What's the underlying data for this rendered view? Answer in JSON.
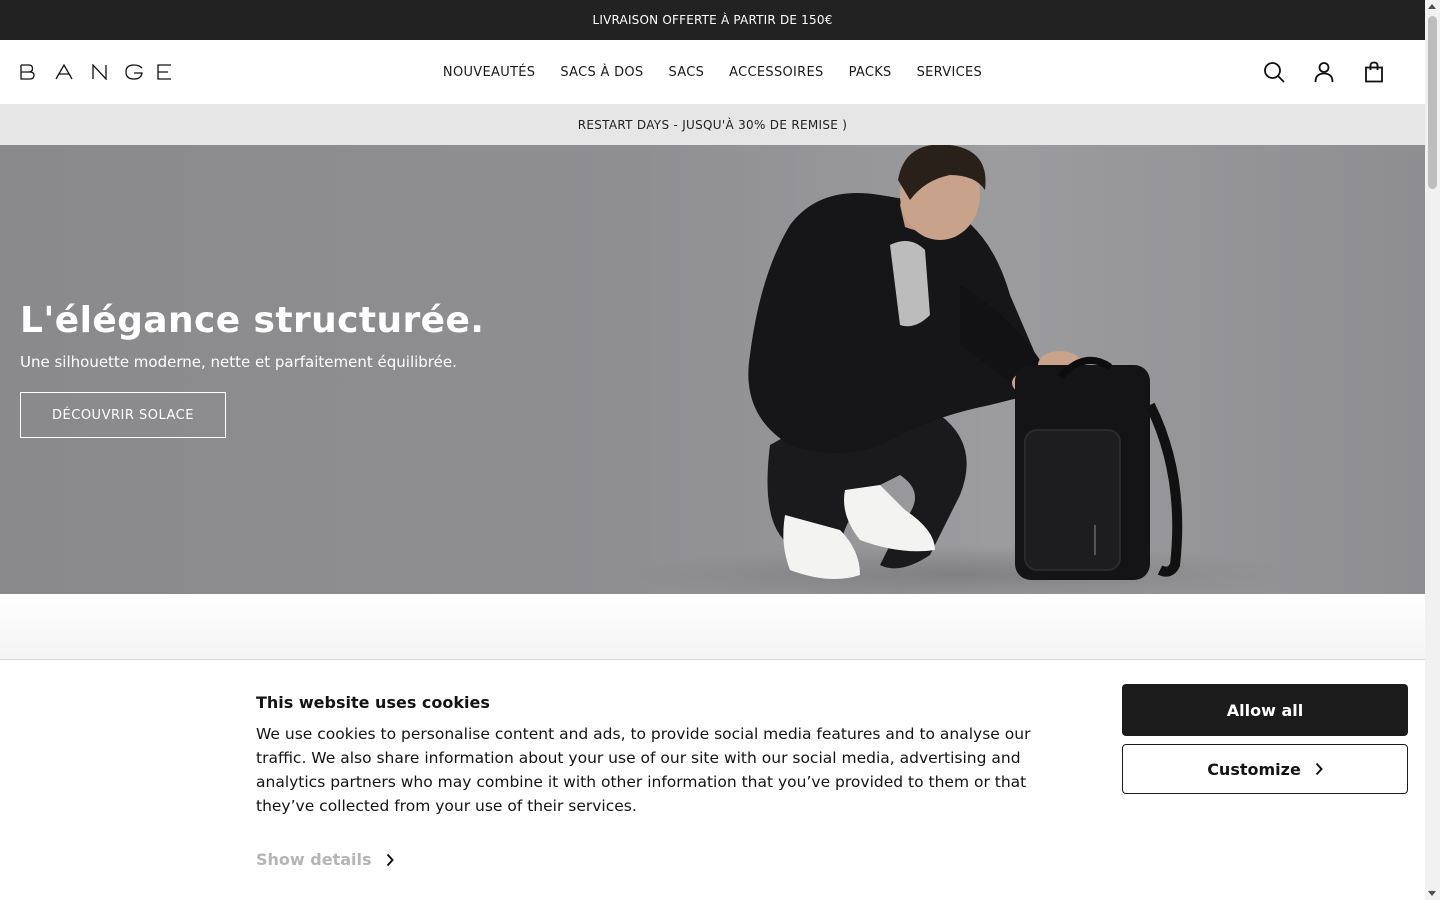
{
  "topbar": {
    "text": "LIVRAISON OFFERTE À PARTIR DE 150€"
  },
  "header": {
    "logo": "BANGE",
    "nav": [
      "NOUVEAUTÉS",
      "SACS À DOS",
      "SACS",
      "ACCESSOIRES",
      "PACKS",
      "SERVICES"
    ],
    "icons": [
      "search-icon",
      "account-icon",
      "bag-icon"
    ]
  },
  "promo": {
    "text": "RESTART DAYS - JUSQU'À 30% DE REMISE )"
  },
  "hero": {
    "title": "L'élégance structurée.",
    "subtitle": "Une silhouette moderne, nette et parfaitement équilibrée.",
    "cta": "DÉCOUVRIR SOLACE"
  },
  "cookie": {
    "title": "This website uses cookies",
    "body": "We use cookies to personalise content and ads, to provide social media features and to analyse our traffic. We also share information about your use of our site with our social media, advertising and analytics partners who may combine it with other information that you’ve provided to them or that they’ve collected from your use of their services.",
    "show_details": "Show details",
    "allow_all": "Allow all",
    "customize": "Customize"
  },
  "colors": {
    "topbar_bg": "#222222",
    "promo_bg": "#e6e6e6",
    "hero_bg": "#8f8f92",
    "primary_button": "#1c1c1c",
    "muted_link": "#b5b5b5"
  }
}
